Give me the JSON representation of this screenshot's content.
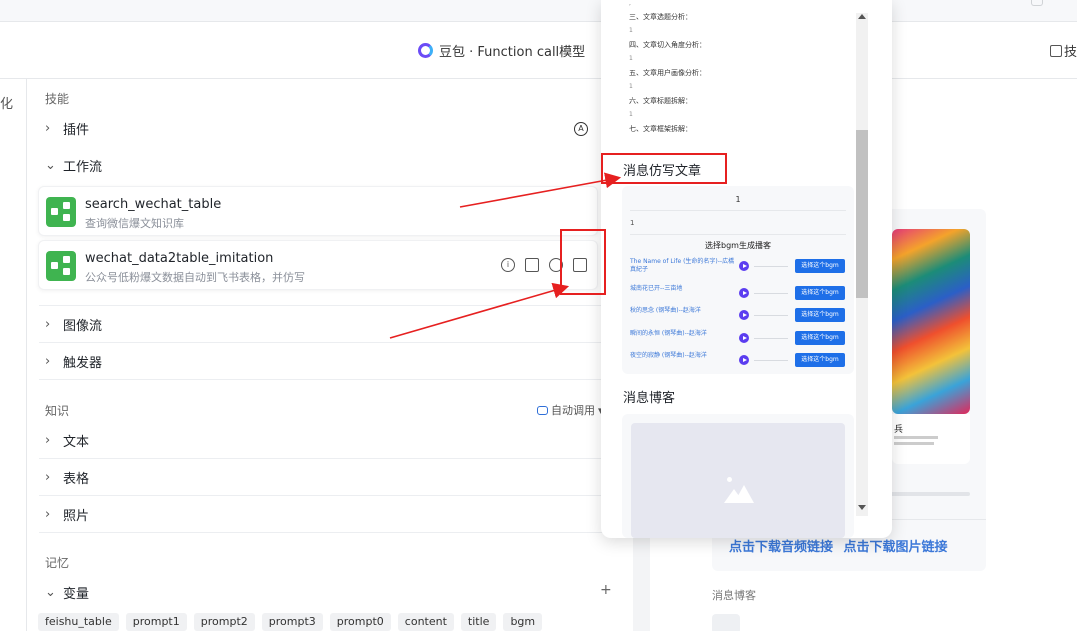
{
  "header": {
    "model_label": "豆包 · Function call模型",
    "right_label": "技"
  },
  "left_strip": {
    "label": "化"
  },
  "skills": {
    "title": "技能",
    "plugins": "插件",
    "workflow": "工作流",
    "workflows": [
      {
        "name": "search_wechat_table",
        "desc": "查询微信爆文知识库"
      },
      {
        "name": "wechat_data2table_imitation",
        "desc": "公众号低粉爆文数据自动到飞书表格，并仿写"
      }
    ],
    "image_flow": "图像流",
    "trigger": "触发器"
  },
  "knowledge": {
    "title": "知识",
    "auto_call": "自动调用",
    "items": [
      "文本",
      "表格",
      "照片"
    ]
  },
  "memory": {
    "title": "记忆",
    "variables": "变量",
    "tags": [
      "feishu_table",
      "prompt1",
      "prompt2",
      "prompt3",
      "prompt0",
      "content",
      "title",
      "bgm"
    ]
  },
  "popup": {
    "outline": [
      "三、文章选题分析：",
      "1",
      "四、文章切入角度分析：",
      "1",
      "五、文章用户画像分析：",
      "1",
      "六、文章标题拆解：",
      "1",
      "七、文章框架拆解："
    ],
    "imitation_title": "消息仿写文章",
    "chat_one": "1",
    "chat_sub": "1",
    "bgm_title": "选择bgm生成播客",
    "songs": [
      "The Name of Life (生命的名字)--広橋真紀子",
      "城南花已开--三亩地",
      "秋的思念 (钢琴曲)--赵海洋",
      "瞬间的永恒 (钢琴曲)--赵海洋",
      "夜空的寂静 (钢琴曲)--赵海洋"
    ],
    "song_button": "选择这个bgm",
    "blog_title": "消息博客"
  },
  "right": {
    "art_caption": "兵",
    "link_audio": "点击下载音频链接",
    "link_image": "点击下载图片链接",
    "blog_label": "消息博客"
  },
  "colors": {
    "accent": "#3c78d8",
    "button": "#1e6fe8",
    "annotation": "#e62020",
    "workflow_icon": "#3fb450"
  }
}
